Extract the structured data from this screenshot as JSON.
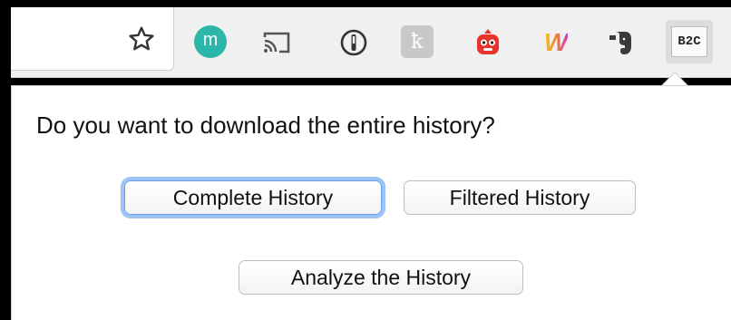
{
  "toolbar": {
    "extensions": [
      {
        "name": "m-extension",
        "glyph": "m",
        "color": "#2cb6a8"
      },
      {
        "name": "cast",
        "icon": "cast-icon"
      },
      {
        "name": "onepassword",
        "icon": "1password-icon"
      },
      {
        "name": "k-extension",
        "glyph": "ꝁ",
        "color": "#c8c8c8"
      },
      {
        "name": "red-robot",
        "icon": "robot-icon",
        "color": "#e8322b"
      },
      {
        "name": "w-extension",
        "glyph": "W"
      },
      {
        "name": "evernote",
        "icon": "elephant-icon"
      },
      {
        "name": "b2c",
        "label": "B2C"
      }
    ]
  },
  "popup": {
    "question": "Do you want to download the entire history?",
    "buttons": {
      "complete": "Complete History",
      "filtered": "Filtered History",
      "analyze": "Analyze the History"
    }
  }
}
